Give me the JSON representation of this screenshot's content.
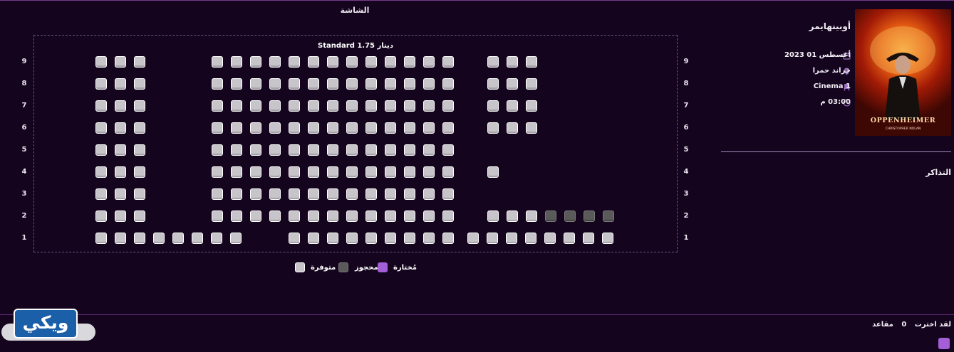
{
  "screen_label": "الشاشة",
  "price_label": "Standard 1.75 دينار",
  "rows": [
    "9",
    "8",
    "7",
    "6",
    "5",
    "4",
    "3",
    "2",
    "1"
  ],
  "legend": {
    "available": "متوفرة",
    "reserved": "محجوز",
    "selected": "مُختارة"
  },
  "colors": {
    "available": "#c8c5ca",
    "reserved": "#5a5a5a",
    "selected": "#a45ed6",
    "background": "#14041d"
  },
  "movie": {
    "title": "أوبينهايمر",
    "date": "أغسطس 01 2023",
    "date_icon": "calendar-icon",
    "venue": "جراند حمرا",
    "venue_icon": "location-pin-icon",
    "hall": "Cinema 1",
    "hall_icon": "seat-icon",
    "time": "03:00 م",
    "time_icon": "clock-icon",
    "poster_title": "OPPENHEIMER",
    "poster_credit": "CHRISTOPHER NOLAN"
  },
  "tickets_title": "التذاكر",
  "summary": {
    "prefix": "لقد اخترت",
    "count": "0",
    "suffix": "مقاعد"
  },
  "logo_text": "ويكي"
}
